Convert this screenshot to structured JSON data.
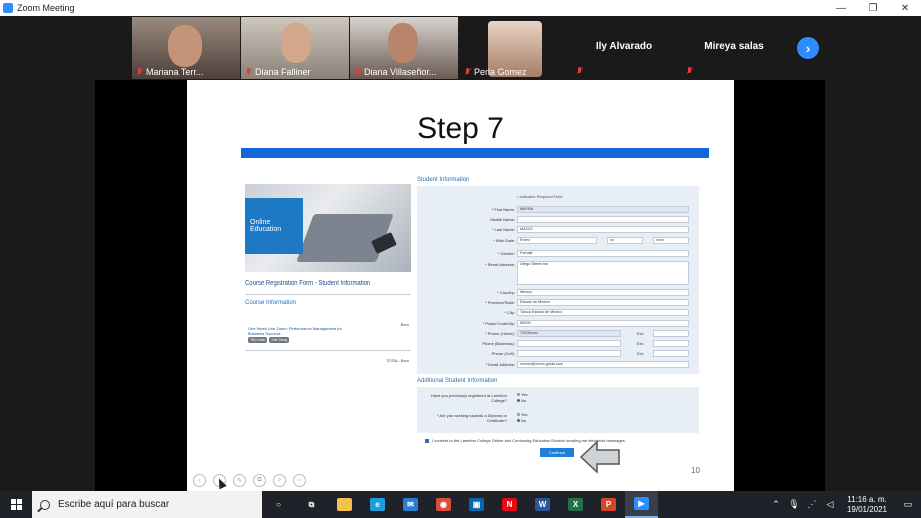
{
  "window": {
    "title": "Zoom Meeting",
    "controls": [
      "—",
      "❐",
      "✕"
    ]
  },
  "participants": [
    {
      "name": "Mariana Terr...",
      "color": "#6a5a52"
    },
    {
      "name": "Diana Falliner",
      "color": "#8d857c"
    },
    {
      "name": "Diana Villaseñor...",
      "color": "#5d5049"
    },
    {
      "name": "Perla Gomez",
      "color": "#3a3a3a"
    }
  ],
  "name_tiles": [
    {
      "name": "Ily Alvarado"
    },
    {
      "name": "Mireya salas"
    }
  ],
  "gallery_next_icon": "›",
  "slide": {
    "title": "Step 7",
    "number": "10",
    "left": {
      "badge": "Online Education",
      "reg_title": "Course Registration Form - Student Information",
      "course_info": "Course Information",
      "course_name": "One Week Live Zoom: Performance Management for Business Success",
      "price": "$xxx",
      "tags": [
        "TBD Date",
        "Self Study"
      ],
      "total": "TOTAL: $xxx"
    },
    "student_info_head": "Student Information",
    "required_note": "• Indicates Required Field",
    "fields": [
      {
        "label": "* First Name:",
        "value": "MAYRA",
        "hl": true
      },
      {
        "label": "Middle Name:",
        "value": ""
      },
      {
        "label": "* Last Name:",
        "value": "MACIO"
      },
      {
        "label": "* Birth Date:",
        "value": "Enero"
      },
      {
        "label": "* Gender:",
        "value": "Female"
      },
      {
        "label": "* Street Address:",
        "value": "Otego Street xxx"
      },
      {
        "label": "* Country:",
        "value": "Mexico"
      },
      {
        "label": "* Province/State:",
        "value": "Estado de Mexico"
      },
      {
        "label": "* City:",
        "value": "Toluca Estado de México"
      },
      {
        "label": "* Postal Code/Zip:",
        "value": "50000"
      },
      {
        "label": "* Phone (Home):",
        "value": "72200xxxx",
        "ext": "Ext:"
      },
      {
        "label": "Phone (Business):",
        "value": "",
        "ext": "Ext:"
      },
      {
        "label": "Phone (Cell):",
        "value": "",
        "ext": "Ext:"
      },
      {
        "label": "* Email Address:",
        "value": "xxxxxx@xxxxx.gmail.com"
      }
    ],
    "birth_day": "xx",
    "birth_year": "xxxx",
    "addl_head": "Additional Student Information",
    "q1": "Have you previously registered at Lambton College?",
    "q2": "* Are you working towards a Diploma or Certificate?",
    "yes": "Yes",
    "no": "No",
    "consent": "I consent to the Lambton College Online and Continuing Education Division sending me electronic messages.",
    "continue_label": "Continue"
  },
  "slide_controls": [
    "‹",
    "›",
    "✎",
    "⧉",
    "⌕",
    "⋯"
  ],
  "taskbar": {
    "search_placeholder": "Escribe aquí para buscar",
    "apps": [
      {
        "name": "cortana",
        "glyph": "○",
        "color": "transparent"
      },
      {
        "name": "task-view",
        "glyph": "⧉",
        "color": "transparent"
      },
      {
        "name": "file-explorer",
        "glyph": "",
        "color": "#f2c14e"
      },
      {
        "name": "edge",
        "glyph": "e",
        "color": "#1b9de2"
      },
      {
        "name": "mail",
        "glyph": "✉",
        "color": "#2b7cd3"
      },
      {
        "name": "chrome",
        "glyph": "◉",
        "color": "#dd4b39"
      },
      {
        "name": "outlook-store",
        "glyph": "▣",
        "color": "#0a64ad"
      },
      {
        "name": "netflix",
        "glyph": "N",
        "color": "#e50914"
      },
      {
        "name": "word",
        "glyph": "W",
        "color": "#2b579a"
      },
      {
        "name": "excel",
        "glyph": "X",
        "color": "#217346"
      },
      {
        "name": "powerpoint",
        "glyph": "P",
        "color": "#d24726"
      },
      {
        "name": "zoom",
        "glyph": "▶",
        "color": "#2d8cff"
      }
    ],
    "time": "11:16 a. m.",
    "date": "19/01/2021"
  }
}
